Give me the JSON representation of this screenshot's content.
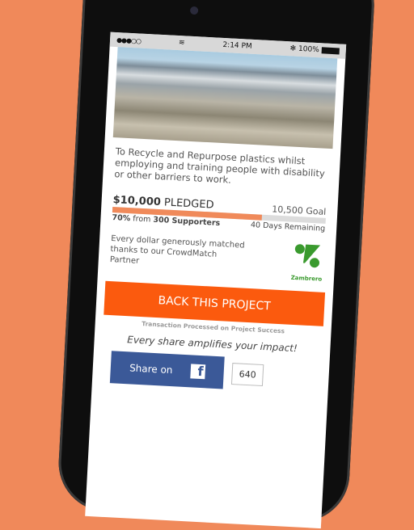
{
  "status_bar": {
    "signal": "●●●○○",
    "wifi": "wifi-icon",
    "time": "2:14 PM",
    "bluetooth": "✻",
    "battery": "100%"
  },
  "project": {
    "description": "To Recycle and Repurpose plastics whilst employing and training people with disability or other barriers to work.",
    "pledged_amount": "$10,000",
    "pledged_label": "PLEDGED",
    "goal": "10,500 Goal",
    "progress_percent": 70,
    "percent_text": "70%",
    "from_text": "from",
    "supporters": "300 Supporters",
    "days_remaining": "40 Days Remaining"
  },
  "match": {
    "text": "Every dollar generously matched thanks to our CrowdMatch Partner",
    "partner": "Zambrero",
    "partner_color": "#3a9a2e"
  },
  "cta": {
    "label": "BACK THIS PROJECT",
    "note": "Transaction Processed on Project Success",
    "color": "#fb5a0e"
  },
  "share": {
    "tagline": "Every share amplifies your impact!",
    "facebook_label": "Share on",
    "facebook_glyph": "f",
    "count": "640",
    "facebook_color": "#3b5998"
  },
  "background_color": "#f0895a"
}
